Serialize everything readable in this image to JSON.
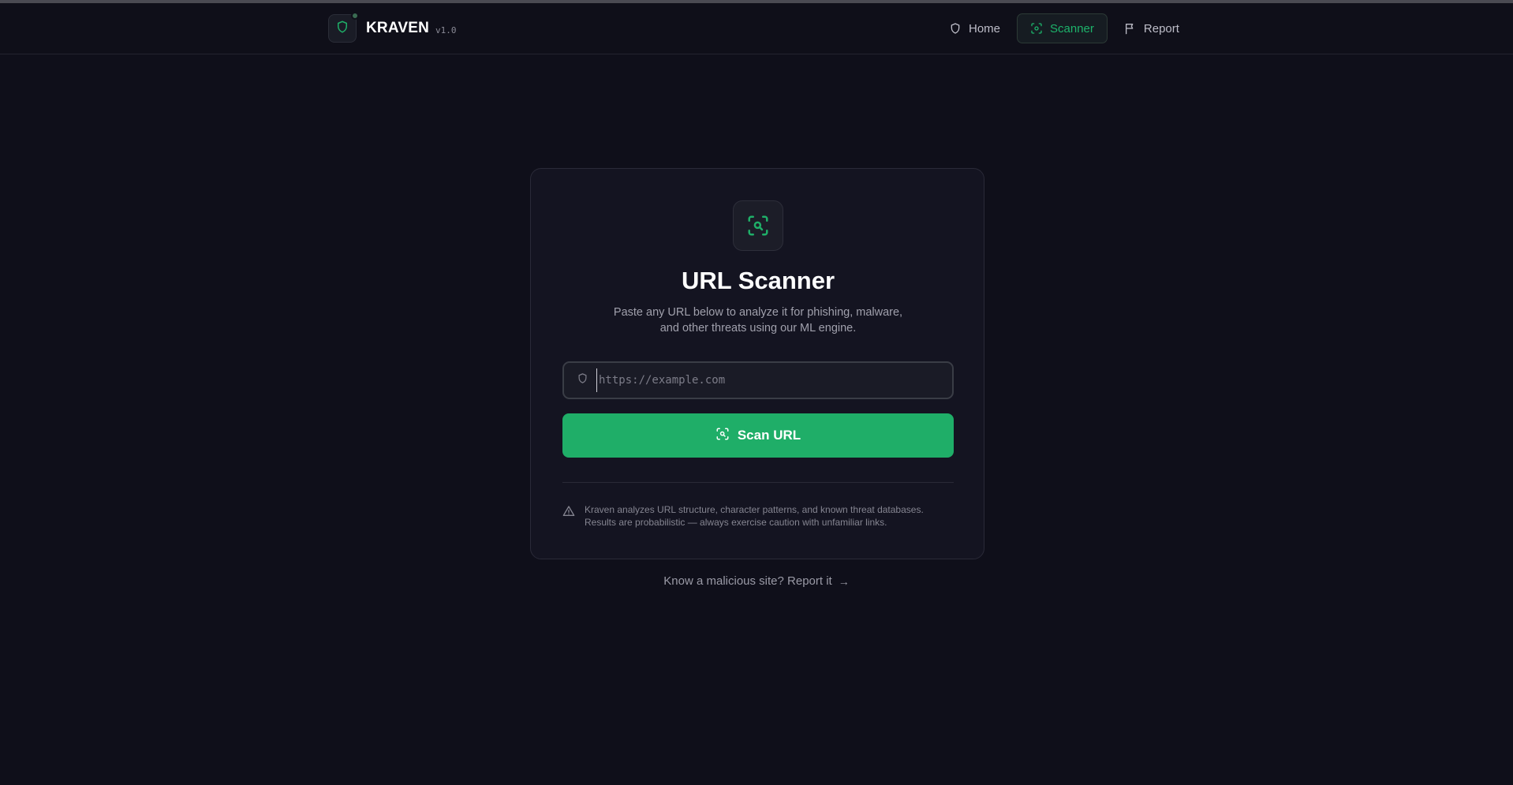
{
  "brand": {
    "name": "KRAVEN",
    "version": "v1.0",
    "logo_icon": "shield-icon",
    "status_dot_color": "#3a6b52"
  },
  "nav": {
    "items": [
      {
        "label": "Home",
        "icon": "shield-icon",
        "active": false
      },
      {
        "label": "Scanner",
        "icon": "scan-icon",
        "active": true
      },
      {
        "label": "Report",
        "icon": "flag-icon",
        "active": false
      }
    ]
  },
  "card": {
    "icon": "scan-search-icon",
    "title": "URL Scanner",
    "description_line1": "Paste any URL below to analyze it for phishing, malware,",
    "description_line2": "and other threats using our ML engine.",
    "url_input": {
      "placeholder": "https://example.com",
      "value": ""
    },
    "scan_button_label": "Scan URL",
    "disclaimer_line1": "Kraven analyzes URL structure, character patterns, and known threat databases.",
    "disclaimer_line2": "Results are probabilistic — always exercise caution with unfamiliar links."
  },
  "footer": {
    "report_link_text": "Know a malicious site? Report it",
    "report_link_arrow": "→"
  },
  "colors": {
    "accent": "#1fae68",
    "background": "#0f0f1a",
    "card": "#141421"
  }
}
